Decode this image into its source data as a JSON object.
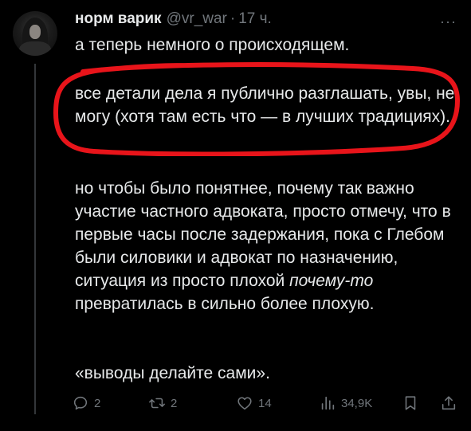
{
  "post": {
    "author": {
      "display_name": "норм варик",
      "handle": "@vr_war",
      "separator": "·",
      "time": "17 ч."
    },
    "paragraph_1": "а теперь немного о происходящем.",
    "paragraph_2": "все детали дела я публично разглашать, увы, не могу (хотя там есть что — в лучших традициях).",
    "paragraph_3_before_italic": "но чтобы было понятнее, почему так важно участие частного адвоката, просто отмечу, что в первые часы после задержания, пока с Глебом были силовики и адвокат по назначению, ситуация из просто плохой ",
    "paragraph_3_italic": "почему-то",
    "paragraph_3_after_italic": " превратилась в сильно более плохую.",
    "paragraph_4": "«выводы делайте сами».",
    "more_label": "···"
  },
  "actions": {
    "reply": {
      "icon": "reply-icon",
      "count": "2"
    },
    "retweet": {
      "icon": "retweet-icon",
      "count": "2"
    },
    "like": {
      "icon": "heart-icon",
      "count": "14"
    },
    "views": {
      "icon": "views-icon",
      "count": "34,9K"
    },
    "bookmark": {
      "icon": "bookmark-icon"
    },
    "share": {
      "icon": "share-icon"
    }
  },
  "colors": {
    "background": "#000000",
    "text": "#e7e9ea",
    "muted": "#71767b",
    "highlight_annotation": "#e8141a"
  }
}
